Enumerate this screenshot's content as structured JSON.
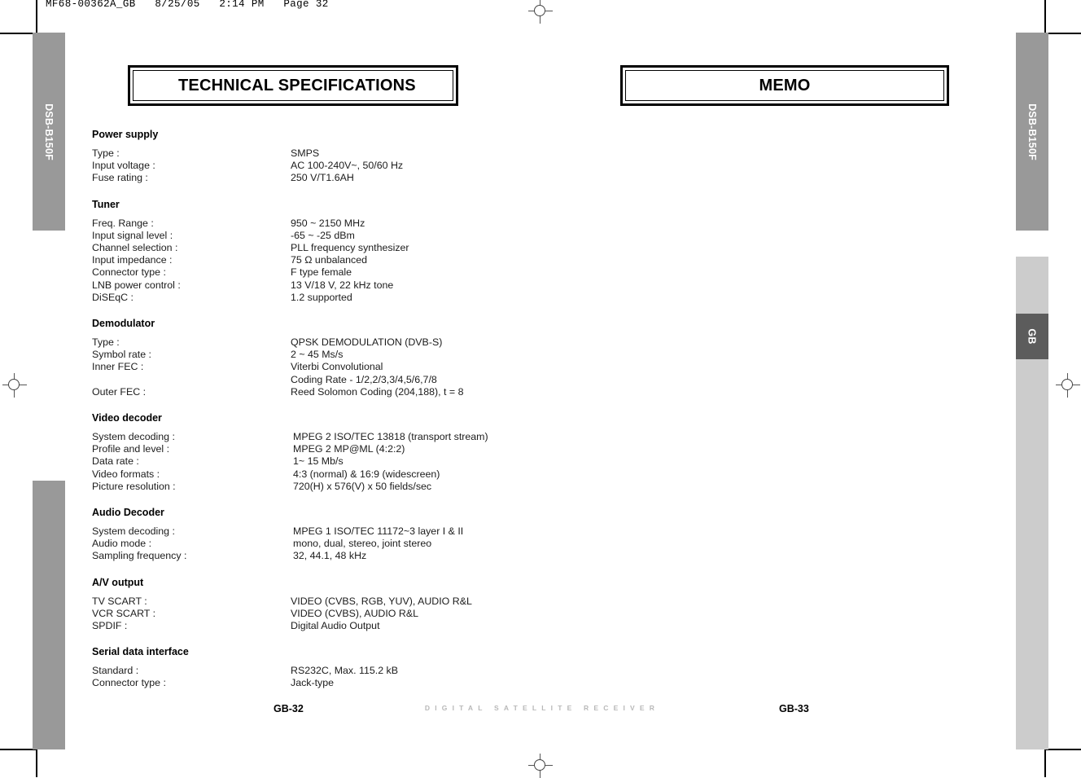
{
  "slug": "MF68-00362A_GB   8/25/05   2:14 PM   Page 32",
  "side_tabs": {
    "left": [
      {
        "name": "tab-dsb-b150f-left",
        "label": "DSB-B150F",
        "color": "#999999"
      }
    ],
    "right": [
      {
        "name": "tab-dsb-b150f-right",
        "label": "DSB-B150F",
        "color": "#999999"
      },
      {
        "name": "tab-gb",
        "label": "GB",
        "color": "#5c5c5c"
      }
    ]
  },
  "left_page": {
    "banner_title": "TECHNICAL SPECIFICATIONS",
    "page_number": "GB-32",
    "sections": [
      {
        "heading": "Power supply",
        "rows": [
          {
            "label": "Type :",
            "value": "SMPS"
          },
          {
            "label": "Input voltage :",
            "value": "AC 100-240V~, 50/60 Hz"
          },
          {
            "label": "Fuse rating :",
            "value": "250 V/T1.6AH"
          }
        ]
      },
      {
        "heading": "Tuner",
        "rows": [
          {
            "label": "Freq. Range :",
            "value": "950 ~ 2150 MHz"
          },
          {
            "label": "Input signal level :",
            "value": "-65 ~ -25 dBm"
          },
          {
            "label": "Channel selection :",
            "value": "PLL frequency synthesizer"
          },
          {
            "label": "Input impedance :",
            "value": "75 Ω unbalanced"
          },
          {
            "label": "Connector type :",
            "value": "F type female"
          },
          {
            "label": "LNB power control :",
            "value": "13 V/18 V, 22 kHz tone"
          },
          {
            "label": "DiSEqC :",
            "value": "1.2 supported"
          }
        ]
      },
      {
        "heading": "Demodulator",
        "rows": [
          {
            "label": "Type :",
            "value": "QPSK DEMODULATION (DVB-S)"
          },
          {
            "label": "Symbol rate :",
            "value": "2 ~ 45 Ms/s"
          },
          {
            "label": "Inner FEC :",
            "value": "Viterbi Convolutional"
          },
          {
            "label": "",
            "value": "Coding Rate - 1/2,2/3,3/4,5/6,7/8"
          },
          {
            "label": "Outer FEC :",
            "value": "Reed Solomon Coding (204,188), t = 8"
          }
        ]
      },
      {
        "heading": "Video decoder",
        "shifted": true,
        "rows": [
          {
            "label": "System decoding :",
            "value": "MPEG 2 ISO/TEC 13818 (transport stream)"
          },
          {
            "label": "Profile and level :",
            "value": "MPEG 2 MP@ML (4:2:2)"
          },
          {
            "label": "Data rate :",
            "value": "1~ 15 Mb/s"
          },
          {
            "label": "Video formats :",
            "value": "4:3 (normal) & 16:9 (widescreen)"
          },
          {
            "label": "Picture resolution :",
            "value": "720(H) x 576(V) x 50 fields/sec"
          }
        ]
      },
      {
        "heading": "Audio Decoder",
        "shifted": true,
        "rows": [
          {
            "label": "System decoding :",
            "value": "MPEG 1 ISO/TEC 11172~3 layer I & II"
          },
          {
            "label": "Audio mode :",
            "value": "mono, dual, stereo, joint stereo"
          },
          {
            "label": "Sampling frequency :",
            "value": "32, 44.1, 48 kHz"
          }
        ]
      },
      {
        "heading": "A/V output",
        "rows": [
          {
            "label": "TV SCART :",
            "value": "VIDEO (CVBS, RGB, YUV), AUDIO R&L"
          },
          {
            "label": "VCR SCART :",
            "value": "VIDEO (CVBS), AUDIO R&L"
          },
          {
            "label": "SPDIF :",
            "value": "Digital Audio Output"
          }
        ]
      },
      {
        "heading": "Serial data interface",
        "rows": [
          {
            "label": "Standard :",
            "value": "RS232C, Max. 115.2 kB"
          },
          {
            "label": "Connector type :",
            "value": "Jack-type"
          }
        ]
      }
    ]
  },
  "right_page": {
    "banner_title": "MEMO",
    "page_number": "GB-33"
  },
  "footer_brand": "DIGITAL SATELLITE RECEIVER"
}
